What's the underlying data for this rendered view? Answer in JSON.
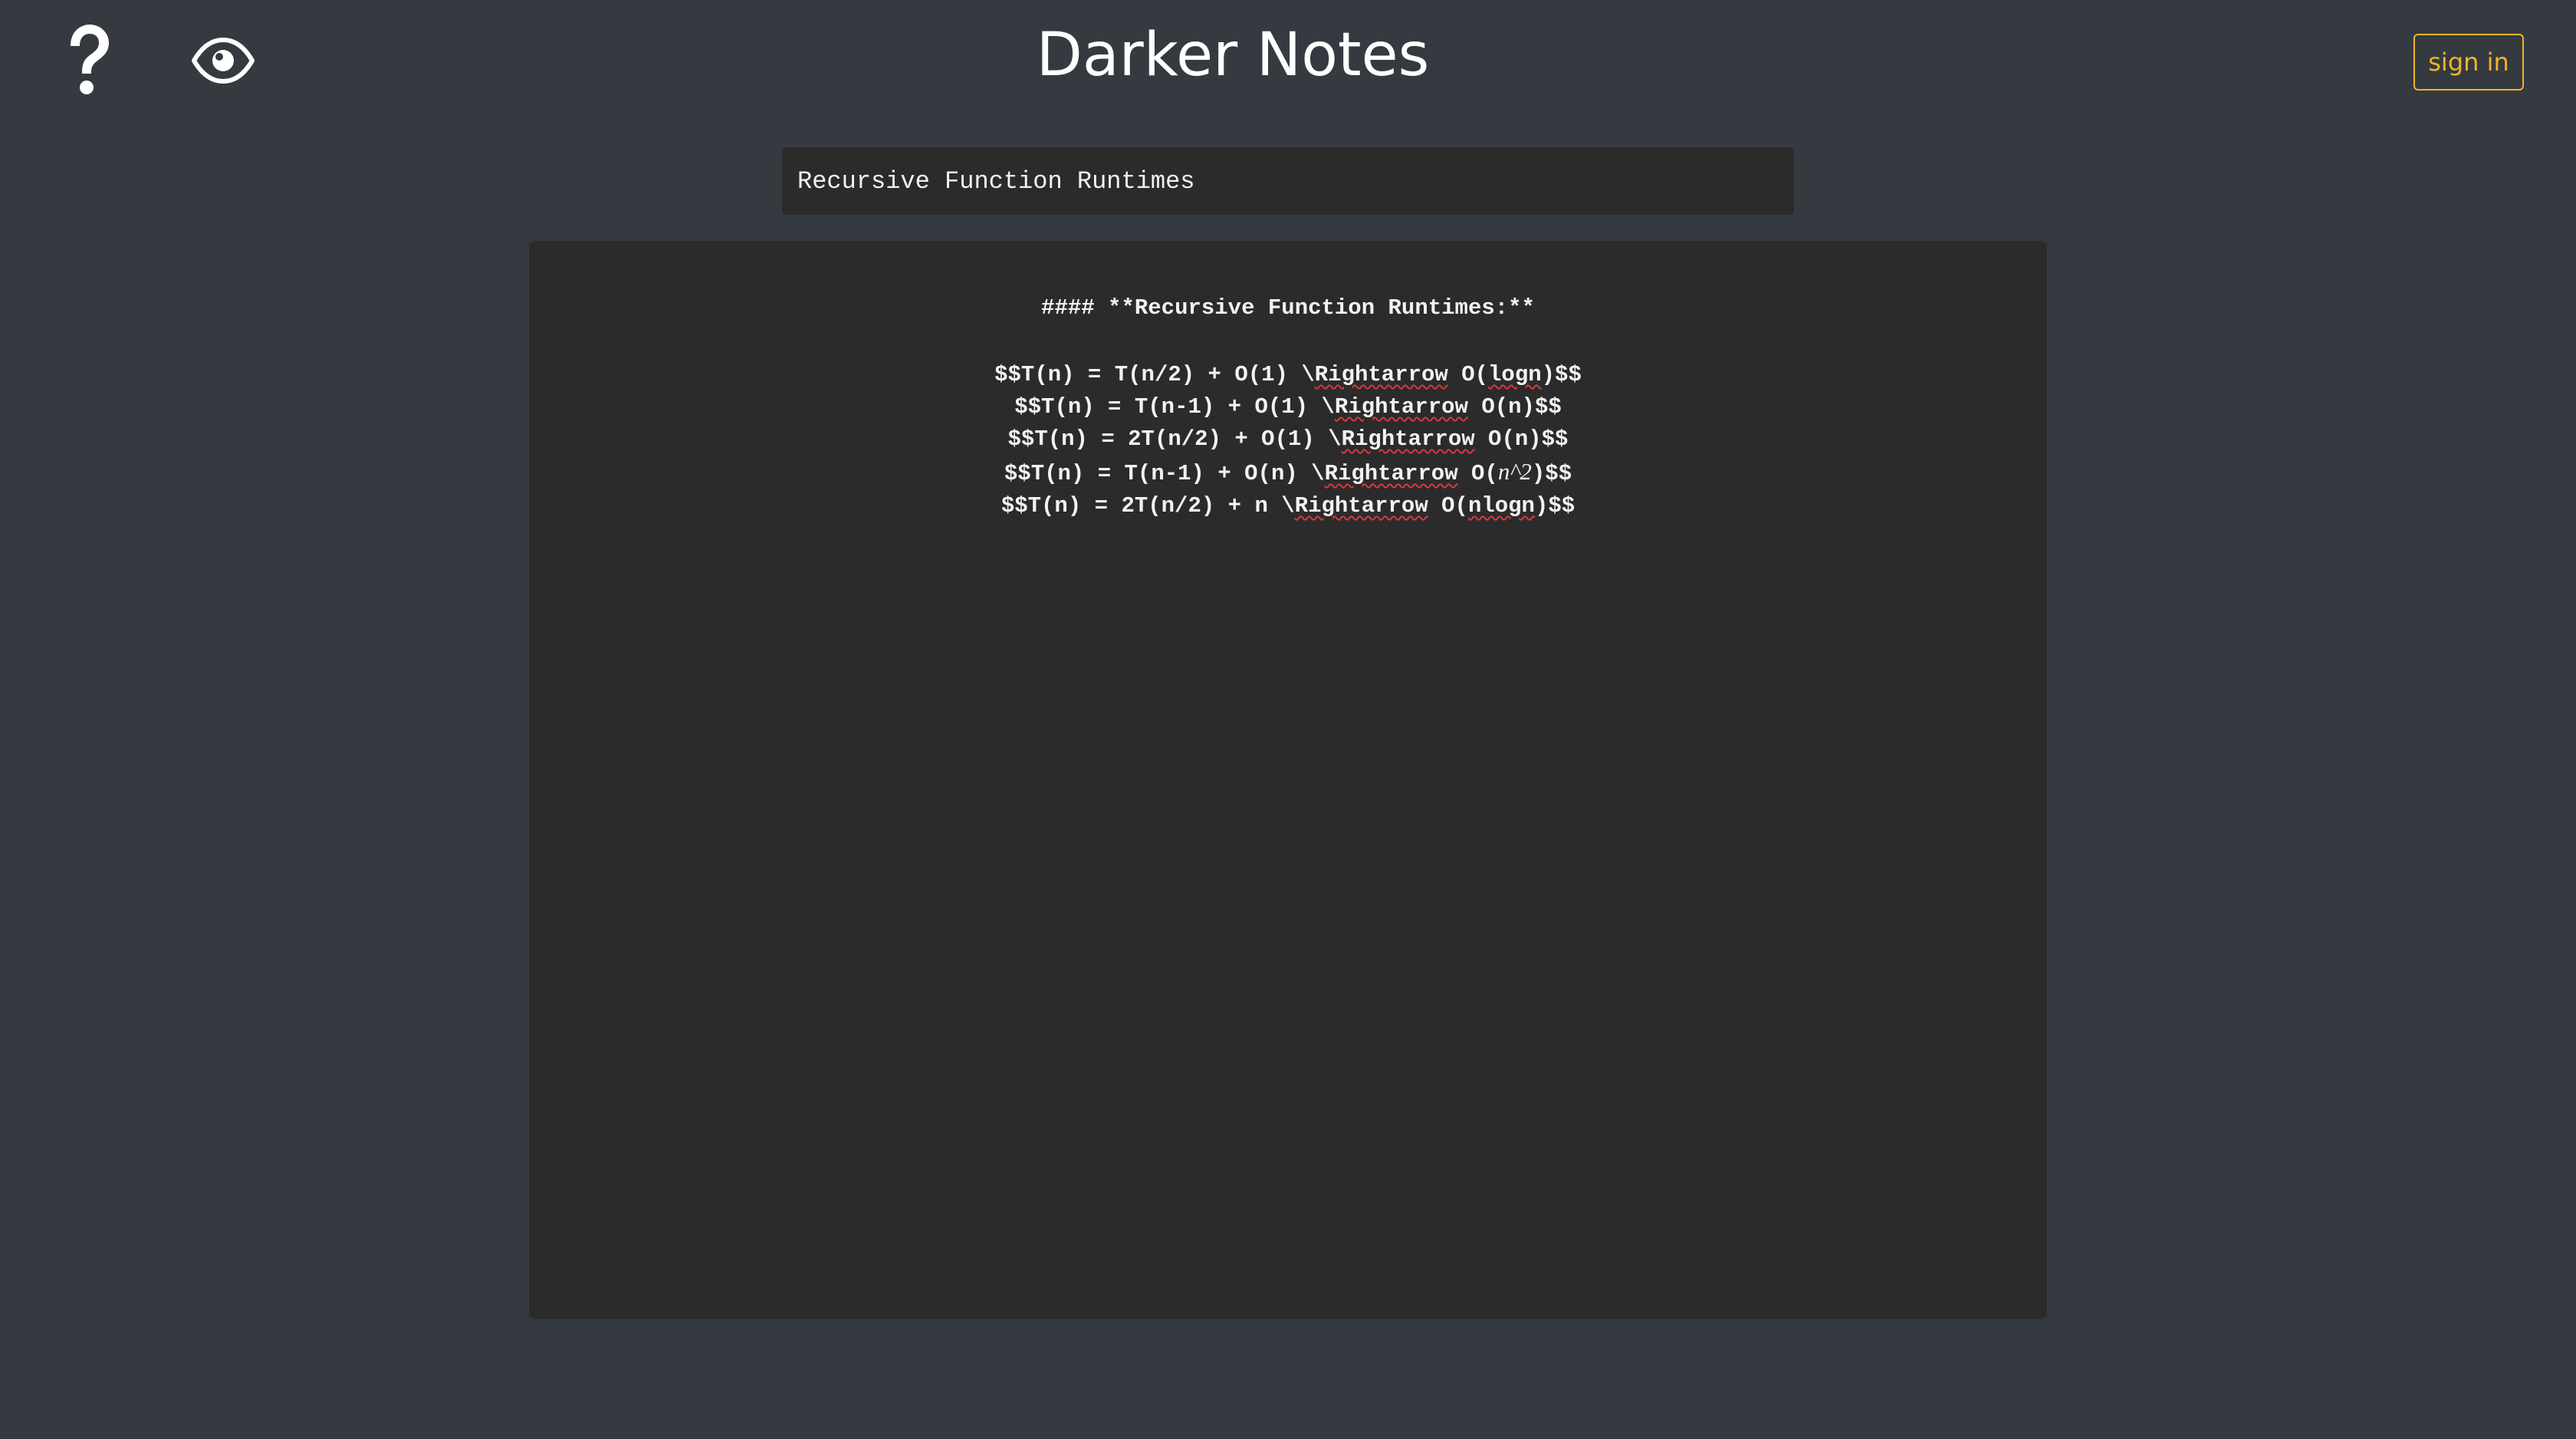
{
  "header": {
    "title": "Darker Notes",
    "sign_in_label": "sign in",
    "help_icon": "question-mark-icon",
    "preview_icon": "eye-icon",
    "accent_color": "#f0b429"
  },
  "note": {
    "title_value": "Recursive Function Runtimes",
    "heading": "#### **Recursive Function Runtimes:**",
    "lines": [
      {
        "pre": "$$T(n) = T(n/2) + O(1) \\",
        "kw": "Rightarrow",
        "mid": " O(",
        "kw2": "logn",
        "math": "",
        "post": ")$$"
      },
      {
        "pre": "$$T(n) = T(n-1) + O(1) \\",
        "kw": "Rightarrow",
        "mid": " O(n)$$",
        "kw2": "",
        "math": "",
        "post": ""
      },
      {
        "pre": "$$T(n) = 2T(n/2) + O(1) \\",
        "kw": "Rightarrow",
        "mid": " O(n)$$",
        "kw2": "",
        "math": "",
        "post": ""
      },
      {
        "pre": "$$T(n) = T(n-1) + O(n) \\",
        "kw": "Rightarrow",
        "mid": " O(",
        "kw2": "",
        "math": "n^2",
        "post": ")$$"
      },
      {
        "pre": "$$T(n) = 2T(n/2) + n \\",
        "kw": "Rightarrow",
        "mid": " O(",
        "kw2": "nlogn",
        "math": "",
        "post": ")$$"
      }
    ]
  },
  "colors": {
    "background": "#343a40",
    "panel": "#2b2b2b",
    "text": "#f2f2f2",
    "spellcheck": "#d63a3a"
  }
}
